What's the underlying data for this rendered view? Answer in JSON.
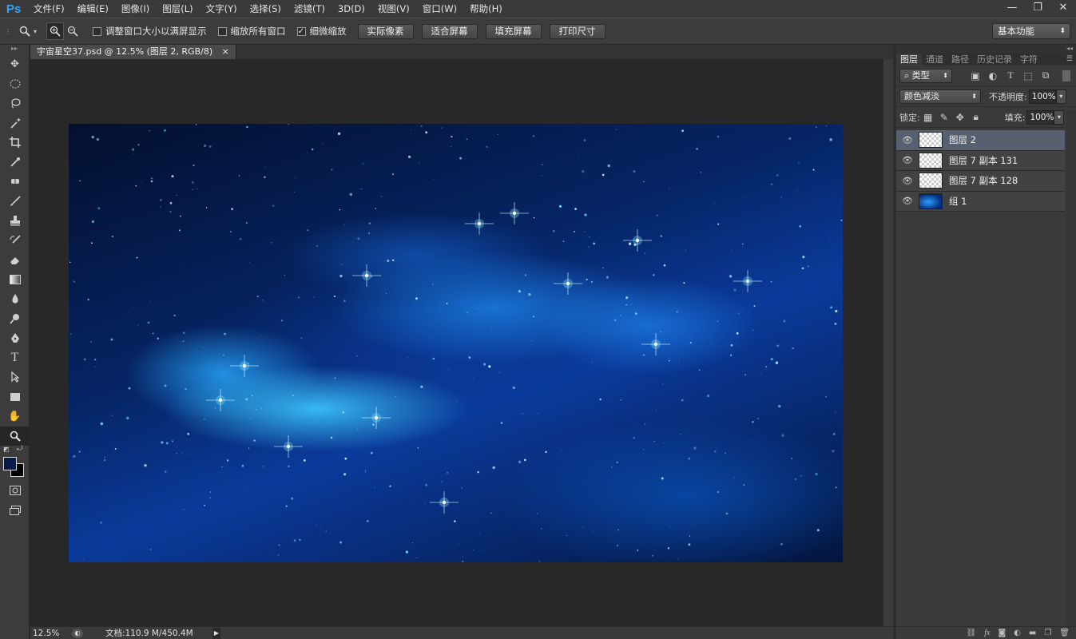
{
  "app": {
    "logo": "Ps"
  },
  "menu": [
    "文件(F)",
    "编辑(E)",
    "图像(I)",
    "图层(L)",
    "文字(Y)",
    "选择(S)",
    "滤镜(T)",
    "3D(D)",
    "视图(V)",
    "窗口(W)",
    "帮助(H)"
  ],
  "window_controls": {
    "minimize": "—",
    "restore": "❐",
    "close": "✕"
  },
  "options": {
    "resize_windows": "调整窗口大小以满屏显示",
    "zoom_all": "缩放所有窗口",
    "scrubby_zoom": "细微缩放",
    "scrubby_checked": "✓",
    "buttons": [
      "实际像素",
      "适合屏幕",
      "填充屏幕",
      "打印尺寸"
    ],
    "workspace": "基本功能"
  },
  "document": {
    "tab_title": "宇宙星空37.psd @ 12.5% (图层 2, RGB/8)",
    "tab_close": "×",
    "zoom": "12.5%",
    "doc_info": "文档:110.9 M/450.4M"
  },
  "panel": {
    "tabs": [
      "图层",
      "通道",
      "路径",
      "历史记录",
      "字符"
    ],
    "filter_kind": "类型",
    "blend_mode": "颜色减淡",
    "opacity_label": "不透明度:",
    "opacity": "100%",
    "lock_label": "锁定:",
    "fill_label": "填充:",
    "fill": "100%",
    "layers": [
      {
        "name": "图层 2",
        "selected": true
      },
      {
        "name": "图层 7 副本 131",
        "selected": false
      },
      {
        "name": "图层 7 副本 128",
        "selected": false
      },
      {
        "name": "组 1",
        "selected": false
      }
    ],
    "footer_icons": [
      "link-icon",
      "fx-icon",
      "mask-icon",
      "adjustment-icon",
      "folder-icon",
      "new-layer-icon",
      "trash-icon"
    ]
  }
}
